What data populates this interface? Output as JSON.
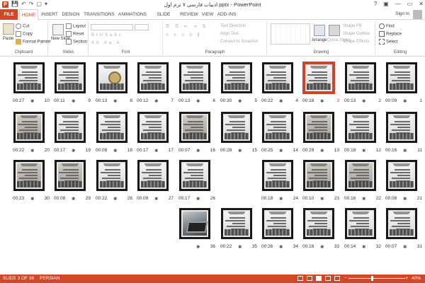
{
  "window": {
    "title": "ادبیات فارسی ۷ ترم اول.pptx - PowerPoint",
    "app_icon_letter": "P",
    "qat": [
      "💾",
      "↶",
      "↷",
      "▢",
      "▾"
    ],
    "controls": [
      "?",
      "▣",
      "—",
      "▭",
      "✕"
    ]
  },
  "tabs": [
    "FILE",
    "HOME",
    "INSERT",
    "DESIGN",
    "TRANSITIONS",
    "ANIMATIONS",
    "SLIDE SHOW",
    "REVIEW",
    "VIEW",
    "ADD-INS"
  ],
  "active_tab": "HOME",
  "signin": "Sign in",
  "ribbon": {
    "clipboard": {
      "label": "Clipboard",
      "paste": "Paste",
      "cut": "Cut",
      "copy": "Copy",
      "format_painter": "Format Painter"
    },
    "slides": {
      "label": "Slides",
      "new_slide": "New Slide",
      "layout": "Layout",
      "reset": "Reset",
      "section": "Section"
    },
    "font": {
      "label": "Font"
    },
    "paragraph": {
      "label": "Paragraph",
      "text_direction": "Text Direction",
      "align_text": "Align Text",
      "convert": "Convert to SmartArt"
    },
    "drawing": {
      "label": "Drawing",
      "arrange": "Arrange",
      "quick_styles": "Quick Styles",
      "shape_fill": "Shape Fill",
      "shape_outline": "Shape Outline",
      "shape_effects": "Shape Effects"
    },
    "editing": {
      "label": "Editing",
      "find": "Find",
      "replace": "Replace",
      "select": "Select"
    }
  },
  "slides": [
    {
      "n": "10",
      "time": "00:27",
      "row": 0,
      "col": 0,
      "style": "text"
    },
    {
      "n": "9",
      "time": "00:11",
      "row": 0,
      "col": 1,
      "style": "text"
    },
    {
      "n": "8",
      "time": "00:13",
      "row": 0,
      "col": 2,
      "style": "medal"
    },
    {
      "n": "7",
      "time": "00:12",
      "row": 0,
      "col": 3,
      "style": "text"
    },
    {
      "n": "6",
      "time": "00:13",
      "row": 0,
      "col": 4,
      "style": "text"
    },
    {
      "n": "5",
      "time": "00:30",
      "row": 0,
      "col": 5,
      "style": "text"
    },
    {
      "n": "4",
      "time": "00:22",
      "row": 0,
      "col": 6,
      "style": "text"
    },
    {
      "n": "3",
      "time": "00:18",
      "row": 0,
      "col": 7,
      "style": "text",
      "selected": true
    },
    {
      "n": "2",
      "time": "00:13",
      "row": 0,
      "col": 8,
      "style": "text"
    },
    {
      "n": "1",
      "time": "00:09",
      "row": 0,
      "col": 9,
      "style": "text"
    },
    {
      "n": "20",
      "time": "00:22",
      "row": 1,
      "col": 0,
      "style": "dark"
    },
    {
      "n": "19",
      "time": "00:17",
      "row": 1,
      "col": 1,
      "style": "text"
    },
    {
      "n": "18",
      "time": "00:08",
      "row": 1,
      "col": 2,
      "style": "text"
    },
    {
      "n": "17",
      "time": "00:17",
      "row": 1,
      "col": 3,
      "style": "text"
    },
    {
      "n": "16",
      "time": "00:07",
      "row": 1,
      "col": 4,
      "style": "dark"
    },
    {
      "n": "15",
      "time": "00:28",
      "row": 1,
      "col": 5,
      "style": "text"
    },
    {
      "n": "14",
      "time": "00:25",
      "row": 1,
      "col": 6,
      "style": "text"
    },
    {
      "n": "13",
      "time": "00:29",
      "row": 1,
      "col": 7,
      "style": "dark"
    },
    {
      "n": "12",
      "time": "00:18",
      "row": 1,
      "col": 8,
      "style": "text"
    },
    {
      "n": "11",
      "time": "00:16",
      "row": 1,
      "col": 9,
      "style": "text"
    },
    {
      "n": "30",
      "time": "00:23",
      "row": 2,
      "col": 0,
      "style": "dark"
    },
    {
      "n": "29",
      "time": "00:08",
      "row": 2,
      "col": 1,
      "style": "dark"
    },
    {
      "n": "28",
      "time": "00:22",
      "row": 2,
      "col": 2,
      "style": "text"
    },
    {
      "n": "27",
      "time": "00:09",
      "row": 2,
      "col": 3,
      "style": "text"
    },
    {
      "n": "26",
      "time": "00:17",
      "row": 2,
      "col": 4,
      "style": "text"
    },
    {
      "n": "24",
      "time": "00:18",
      "row": 2,
      "col": 6,
      "style": "text"
    },
    {
      "n": "23",
      "time": "00:10",
      "row": 2,
      "col": 7,
      "style": "dark"
    },
    {
      "n": "22",
      "time": "00:16",
      "row": 2,
      "col": 8,
      "style": "dark"
    },
    {
      "n": "21",
      "time": "00:08",
      "row": 2,
      "col": 9,
      "style": "text"
    },
    {
      "n": "36",
      "time": "",
      "row": 3,
      "col": 4,
      "style": "photo"
    },
    {
      "n": "35",
      "time": "00:22",
      "row": 3,
      "col": 5,
      "style": "text"
    },
    {
      "n": "34",
      "time": "00:26",
      "row": 3,
      "col": 6,
      "style": "text"
    },
    {
      "n": "33",
      "time": "00:16",
      "row": 3,
      "col": 7,
      "style": "text"
    },
    {
      "n": "32",
      "time": "00:14",
      "row": 3,
      "col": 8,
      "style": "text"
    },
    {
      "n": "31",
      "time": "00:07",
      "row": 3,
      "col": 9,
      "style": "text"
    }
  ],
  "slide_star": "✱",
  "status": {
    "slide_label": "SLIDE 3 OF 36",
    "language": "PERSIAN",
    "zoom": "40%",
    "zoom_fraction": 0.4,
    "zoom_minus": "−",
    "zoom_plus": "+"
  },
  "colors": {
    "accent": "#d24726",
    "selection": "#c8462a"
  }
}
